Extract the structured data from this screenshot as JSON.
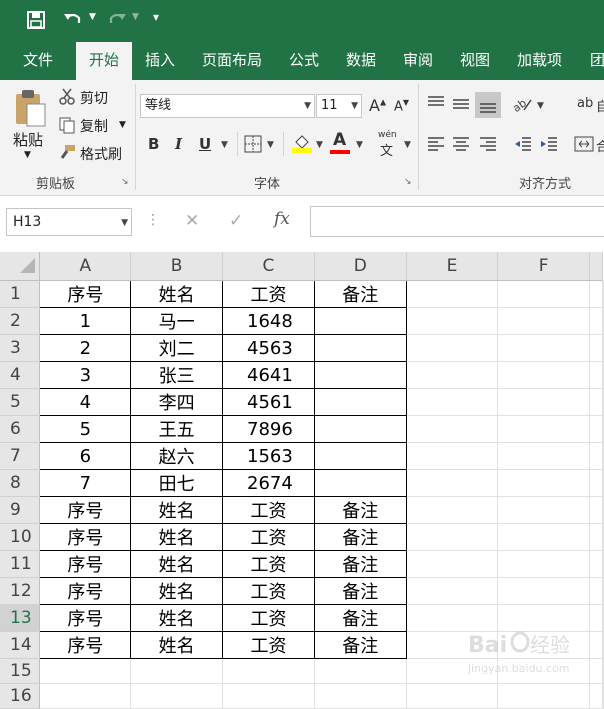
{
  "quick_access": {
    "save_icon": "save-icon",
    "undo_icon": "undo-icon",
    "redo_icon": "redo-icon",
    "customize_icon": "customize-qat-icon"
  },
  "tabs": [
    {
      "label": "文件",
      "active": false
    },
    {
      "label": "开始",
      "active": true
    },
    {
      "label": "插入",
      "active": false
    },
    {
      "label": "页面布局",
      "active": false
    },
    {
      "label": "公式",
      "active": false
    },
    {
      "label": "数据",
      "active": false
    },
    {
      "label": "审阅",
      "active": false
    },
    {
      "label": "视图",
      "active": false
    },
    {
      "label": "加载项",
      "active": false
    },
    {
      "label": "团",
      "active": false
    }
  ],
  "clipboard": {
    "paste": "粘贴",
    "cut": "剪切",
    "copy": "复制",
    "format_painter": "格式刷",
    "group": "剪贴板"
  },
  "font": {
    "name": "等线",
    "size": "11",
    "bold": "B",
    "italic": "I",
    "underline": "U",
    "font_color": "A",
    "phonetic": "wén",
    "group": "字体"
  },
  "alignment": {
    "group": "对齐方式",
    "wrap_partial": "ab",
    "merge_partial": "合"
  },
  "formula_bar": {
    "name_box": "H13",
    "cancel": "✕",
    "enter": "✓",
    "fx": "fx",
    "formula": ""
  },
  "columns": [
    "A",
    "B",
    "C",
    "D",
    "E",
    "F"
  ],
  "rows": [
    {
      "num": "1",
      "cells": [
        "序号",
        "姓名",
        "工资",
        "备注"
      ]
    },
    {
      "num": "2",
      "cells": [
        "1",
        "马一",
        "1648",
        ""
      ]
    },
    {
      "num": "3",
      "cells": [
        "2",
        "刘二",
        "4563",
        ""
      ]
    },
    {
      "num": "4",
      "cells": [
        "3",
        "张三",
        "4641",
        ""
      ]
    },
    {
      "num": "5",
      "cells": [
        "4",
        "李四",
        "4561",
        ""
      ]
    },
    {
      "num": "6",
      "cells": [
        "5",
        "王五",
        "7896",
        ""
      ]
    },
    {
      "num": "7",
      "cells": [
        "6",
        "赵六",
        "1563",
        ""
      ]
    },
    {
      "num": "8",
      "cells": [
        "7",
        "田七",
        "2674",
        ""
      ]
    },
    {
      "num": "9",
      "cells": [
        "序号",
        "姓名",
        "工资",
        "备注"
      ]
    },
    {
      "num": "10",
      "cells": [
        "序号",
        "姓名",
        "工资",
        "备注"
      ]
    },
    {
      "num": "11",
      "cells": [
        "序号",
        "姓名",
        "工资",
        "备注"
      ]
    },
    {
      "num": "12",
      "cells": [
        "序号",
        "姓名",
        "工资",
        "备注"
      ]
    },
    {
      "num": "13",
      "cells": [
        "序号",
        "姓名",
        "工资",
        "备注"
      ]
    },
    {
      "num": "14",
      "cells": [
        "序号",
        "姓名",
        "工资",
        "备注"
      ]
    },
    {
      "num": "15",
      "cells": [
        "",
        "",
        "",
        ""
      ]
    },
    {
      "num": "16",
      "cells": [
        "",
        "",
        "",
        ""
      ]
    }
  ],
  "selected_row": "13",
  "watermark": "Baidu 经验 jingyan.baidu.com",
  "colors": {
    "accent": "#217346",
    "ribbon": "#f3f3f3",
    "header": "#e6e6e6",
    "font_color_bar": "#ff0000",
    "fill_color_bar": "#ffff00"
  }
}
